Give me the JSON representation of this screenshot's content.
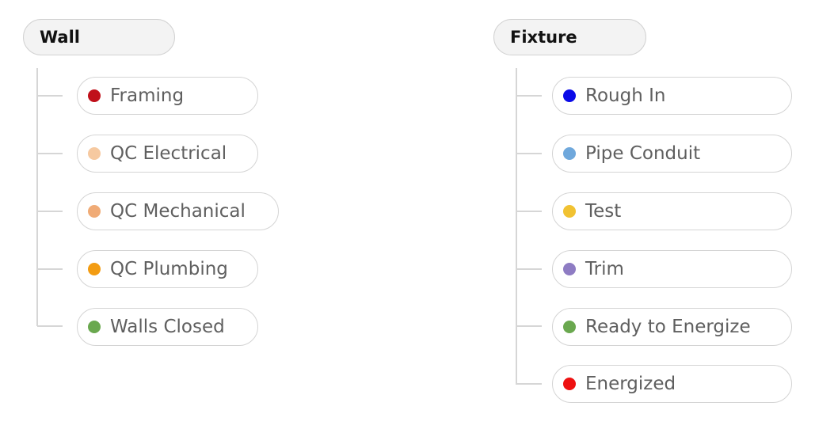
{
  "groups": [
    {
      "title": "Wall",
      "items": [
        {
          "label": "Framing",
          "color": "#c0101a"
        },
        {
          "label": "QC Electrical",
          "color": "#f6c9a0"
        },
        {
          "label": "QC Mechanical",
          "color": "#f0ab76"
        },
        {
          "label": "QC Plumbing",
          "color": "#f39c12"
        },
        {
          "label": "Walls Closed",
          "color": "#6aa84f"
        }
      ]
    },
    {
      "title": "Fixture",
      "items": [
        {
          "label": "Rough In",
          "color": "#0a0ae8"
        },
        {
          "label": "Pipe Conduit",
          "color": "#6fa8dc"
        },
        {
          "label": "Test",
          "color": "#f1c232"
        },
        {
          "label": "Trim",
          "color": "#8e7cc3"
        },
        {
          "label": "Ready to Energize",
          "color": "#6aa84f"
        },
        {
          "label": "Energized",
          "color": "#ee1111"
        }
      ]
    }
  ]
}
